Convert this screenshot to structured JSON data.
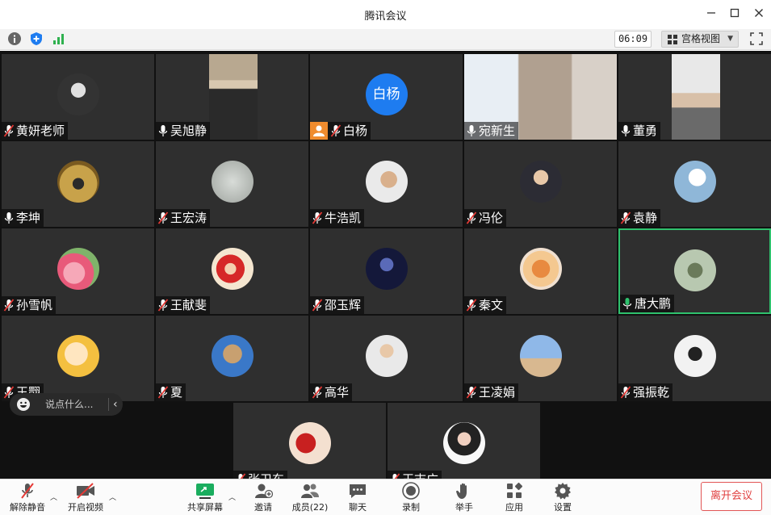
{
  "window": {
    "title": "腾讯会议"
  },
  "infobar": {
    "timer": "06:09",
    "view_label": "宫格视图"
  },
  "participants": [
    {
      "name": "黄妍老师",
      "mic": "muted"
    },
    {
      "name": "吴旭静",
      "mic": "on"
    },
    {
      "name": "白杨",
      "mic": "muted",
      "avatar_text": "白杨",
      "host": true
    },
    {
      "name": "宛新生",
      "mic": "on"
    },
    {
      "name": "董勇",
      "mic": "on"
    },
    {
      "name": "李坤",
      "mic": "on"
    },
    {
      "name": "王宏涛",
      "mic": "muted"
    },
    {
      "name": "牛浩凯",
      "mic": "muted"
    },
    {
      "name": "冯伦",
      "mic": "muted"
    },
    {
      "name": "袁静",
      "mic": "muted"
    },
    {
      "name": "孙雪帆",
      "mic": "muted"
    },
    {
      "name": "王献斐",
      "mic": "muted"
    },
    {
      "name": "邵玉辉",
      "mic": "muted"
    },
    {
      "name": "秦文",
      "mic": "muted"
    },
    {
      "name": "唐大鹏",
      "mic": "speaking"
    },
    {
      "name": "王翾",
      "mic": "muted"
    },
    {
      "name": "夏",
      "mic": "muted"
    },
    {
      "name": "高华",
      "mic": "muted"
    },
    {
      "name": "王凌娟",
      "mic": "muted"
    },
    {
      "name": "强振乾",
      "mic": "muted"
    },
    {
      "name": "张卫东",
      "mic": "muted"
    },
    {
      "name": "王志广",
      "mic": "muted"
    }
  ],
  "chat": {
    "placeholder": "说点什么..."
  },
  "toolbar": {
    "unmute": "解除静音",
    "start_video": "开启视频",
    "share_screen": "共享屏幕",
    "invite": "邀请",
    "members": "成员(22)",
    "chat": "聊天",
    "record": "录制",
    "raise_hand": "举手",
    "apps": "应用",
    "settings": "设置",
    "leave": "离开会议"
  },
  "colors": {
    "accent": "#1e7cf0",
    "active_border": "#2fc16d",
    "leave": "#e04040",
    "muted": "#e53935",
    "share": "#1aad5e"
  }
}
